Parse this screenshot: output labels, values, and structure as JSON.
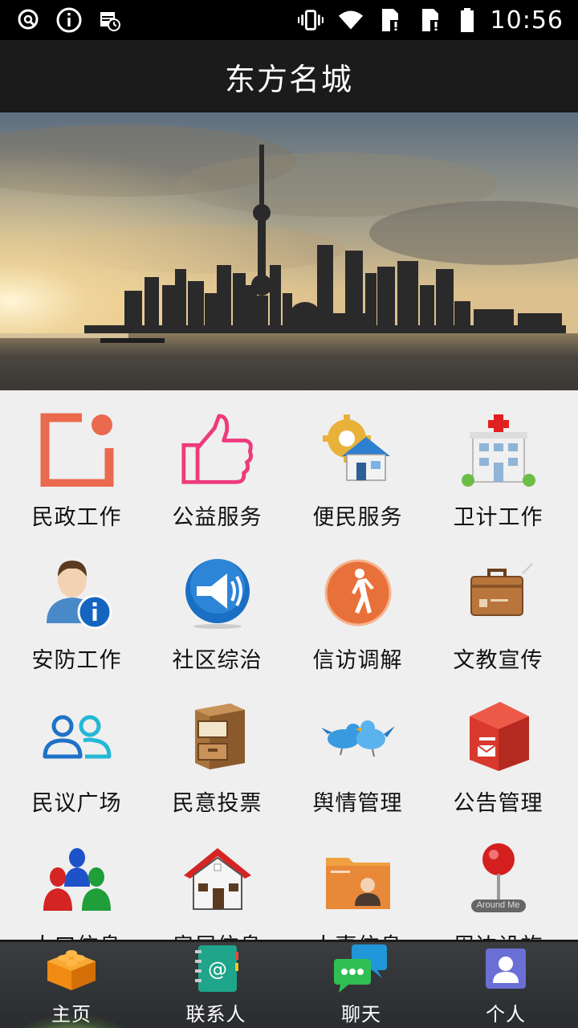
{
  "status_bar": {
    "time": "10:56",
    "left_icons": [
      "search-circle-icon",
      "info-icon",
      "calendar-clock-icon"
    ],
    "right_icons": [
      "vibrate-icon",
      "wifi-icon",
      "sim1-alert-icon",
      "sim2-alert-icon",
      "battery-icon"
    ]
  },
  "app_bar": {
    "title": "东方名城"
  },
  "banner": {
    "image": "city-skyline-photo"
  },
  "grid": {
    "items": [
      {
        "label": "民政工作",
        "icon": "civil-affairs-icon"
      },
      {
        "label": "公益服务",
        "icon": "thumbs-up-icon"
      },
      {
        "label": "便民服务",
        "icon": "house-gear-icon"
      },
      {
        "label": "卫计工作",
        "icon": "hospital-icon"
      },
      {
        "label": "安防工作",
        "icon": "person-info-icon"
      },
      {
        "label": "社区综治",
        "icon": "megaphone-icon"
      },
      {
        "label": "信访调解",
        "icon": "walking-person-icon"
      },
      {
        "label": "文教宣传",
        "icon": "briefcase-icon"
      },
      {
        "label": "民议广场",
        "icon": "two-people-icon"
      },
      {
        "label": "民意投票",
        "icon": "file-cabinet-icon"
      },
      {
        "label": "舆情管理",
        "icon": "birds-icon"
      },
      {
        "label": "公告管理",
        "icon": "mailbox-icon"
      },
      {
        "label": "人口信息",
        "icon": "population-icon"
      },
      {
        "label": "房屋信息",
        "icon": "house-icon"
      },
      {
        "label": "人事信息",
        "icon": "personnel-folder-icon"
      },
      {
        "label": "周边设施",
        "icon": "map-pin-icon"
      }
    ],
    "pin_text": "Around Me"
  },
  "bottom_nav": {
    "items": [
      {
        "label": "主页",
        "icon": "lego-brick-icon",
        "active": true
      },
      {
        "label": "联系人",
        "icon": "address-book-icon",
        "active": false
      },
      {
        "label": "聊天",
        "icon": "chat-bubbles-icon",
        "active": false
      },
      {
        "label": "个人",
        "icon": "profile-icon",
        "active": false
      }
    ]
  },
  "colors": {
    "status_bar_bg": "#000000",
    "app_bar_bg": "#1b1b1b",
    "grid_bg": "#efefef",
    "nav_bg": "#2f3235"
  }
}
